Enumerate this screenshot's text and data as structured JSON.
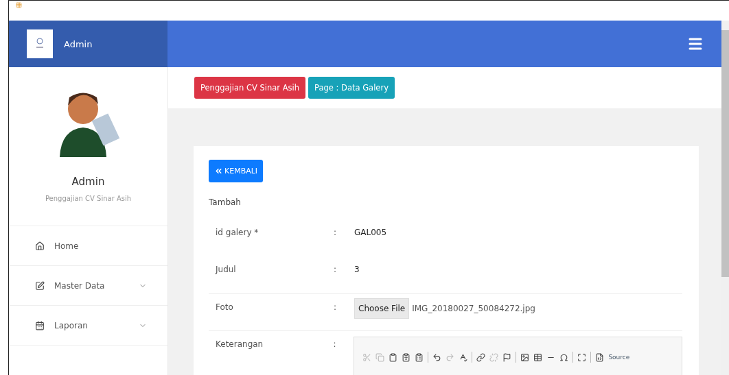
{
  "header": {
    "brand": "Admin"
  },
  "profile": {
    "name": "Admin",
    "subtitle": "Penggajian CV Sinar Asih"
  },
  "sidebar": {
    "items": [
      {
        "label": "Home",
        "expandable": false
      },
      {
        "label": "Master Data",
        "expandable": true
      },
      {
        "label": "Laporan",
        "expandable": true
      }
    ]
  },
  "breadcrumb": [
    {
      "label": "Penggajian CV Sinar Asih",
      "color": "#dc3545"
    },
    {
      "label": "Page : Data Galery",
      "color": "#17a2b8"
    }
  ],
  "back_button": "KEMBALI",
  "form": {
    "title": "Tambah",
    "rows": [
      {
        "kind": "text",
        "label": "id galery *",
        "separator": ":",
        "value": "GAL005"
      },
      {
        "kind": "text",
        "label": "Judul",
        "separator": ":",
        "value": "3"
      },
      {
        "kind": "file",
        "label": "Foto",
        "separator": ":",
        "button": "Choose File",
        "value": "IMG_20180027_50084272.jpg"
      },
      {
        "kind": "editor",
        "label": "Keterangan",
        "separator": ":",
        "source": "Source"
      }
    ]
  }
}
